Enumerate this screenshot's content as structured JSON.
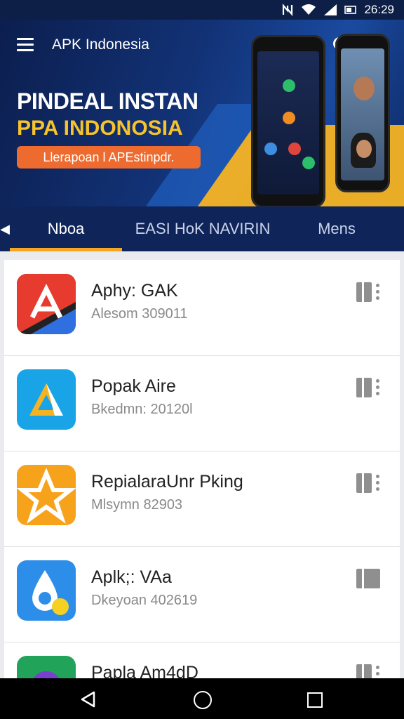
{
  "status_bar": {
    "time": "26:29",
    "icons": [
      "nfc-icon",
      "wifi-icon",
      "signal-icon",
      "battery-icon"
    ]
  },
  "app_bar": {
    "title": "APK Indonesia",
    "menu_icon": "hamburger-icon",
    "search_icon": "search-icon",
    "more_icon": "more-vertical-icon"
  },
  "banner": {
    "headline_line1": "PINDEAL INSTAN",
    "headline_line2": "PPA INDONOSIA",
    "cta_label": "Llerapoan l APEstinpdr."
  },
  "tabs": [
    {
      "label": "Nboa",
      "selected": true
    },
    {
      "label": "EASI HoK NAVIRIN",
      "selected": false
    },
    {
      "label": "Mens",
      "selected": false
    }
  ],
  "apps": [
    {
      "name": "Aphy: GAK",
      "subtitle": "Alesom 309011",
      "icon": "red-a-logo-icon",
      "icon_colors": [
        "#e63b2e",
        "#2f6fe0"
      ]
    },
    {
      "name": "Popak Aire",
      "subtitle": "Bkedmn: 20120l",
      "icon": "blue-triangle-logo-icon",
      "icon_colors": [
        "#19a4e8",
        "#f5b323"
      ]
    },
    {
      "name": "RepialaraUnr Pking",
      "subtitle": "Mlsymn 82903",
      "icon": "orange-star-logo-icon",
      "icon_colors": [
        "#f7a21b",
        "#fff"
      ]
    },
    {
      "name": "Aplk;: VAa",
      "subtitle": "Dkeyoan 402619",
      "icon": "blue-drop-logo-icon",
      "icon_colors": [
        "#2c8ee8",
        "#f6d023"
      ]
    },
    {
      "name": "Papla Am4dD",
      "subtitle": "",
      "icon": "green-circle-logo-icon",
      "icon_colors": [
        "#21a35a",
        "#7b3fcf"
      ]
    }
  ],
  "nav_bar": {
    "back": "back-icon",
    "home": "home-icon",
    "recents": "recents-icon"
  }
}
